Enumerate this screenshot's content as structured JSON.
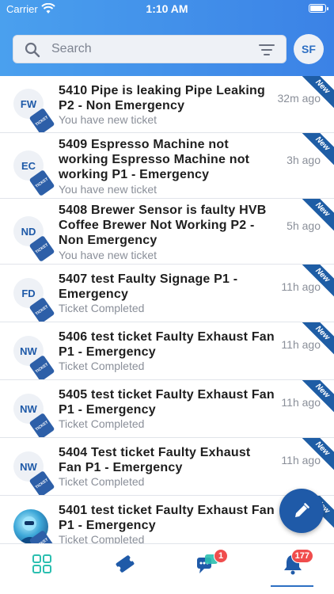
{
  "status_bar": {
    "carrier": "Carrier",
    "time": "1:10 AM"
  },
  "search": {
    "placeholder": "Search"
  },
  "user": {
    "initials": "SF"
  },
  "ribbon_label": "New",
  "ticket_badge_label": "TICKET",
  "tickets": [
    {
      "initials": "FW",
      "title": "5410 Pipe is leaking Pipe Leaking P2 - Non Emergency",
      "subtitle": "You have new ticket",
      "time": "32m ago"
    },
    {
      "initials": "EC",
      "title": "5409 Espresso Machine not working Espresso Machine not working P1 - Emergency",
      "subtitle": "You have new ticket",
      "time": "3h ago"
    },
    {
      "initials": "ND",
      "title": "5408 Brewer Sensor is faulty HVB Coffee Brewer Not Working P2 - Non Emergency",
      "subtitle": "You have new ticket",
      "time": "5h ago"
    },
    {
      "initials": "FD",
      "title": "5407 test Faulty Signage P1 - Emergency",
      "subtitle": "Ticket Completed",
      "time": "11h ago"
    },
    {
      "initials": "NW",
      "title": "5406 test ticket Faulty Exhaust Fan P1 - Emergency",
      "subtitle": "Ticket Completed",
      "time": "11h ago"
    },
    {
      "initials": "NW",
      "title": "5405 test ticket Faulty Exhaust Fan P1 - Emergency",
      "subtitle": "Ticket Completed",
      "time": "11h ago"
    },
    {
      "initials": "NW",
      "title": "5404 Test ticket Faulty Exhaust Fan P1 - Emergency",
      "subtitle": "Ticket Completed",
      "time": "11h ago"
    },
    {
      "initials": "",
      "title": "5401 test ticket Faulty Exhaust Fan P1 - Emergency",
      "subtitle": "Ticket Completed",
      "time": ""
    }
  ],
  "bottom_nav": {
    "items": [
      {
        "icon": "dashboard-grid-icon"
      },
      {
        "icon": "ticket-icon"
      },
      {
        "icon": "chat-icon",
        "badge": "1"
      },
      {
        "icon": "notification-bell-icon",
        "badge": "177"
      }
    ]
  },
  "colors": {
    "header_start": "#4aa0ee",
    "header_end": "#3b82e6",
    "accent": "#1f5aa8",
    "badge": "#f04d4d"
  }
}
